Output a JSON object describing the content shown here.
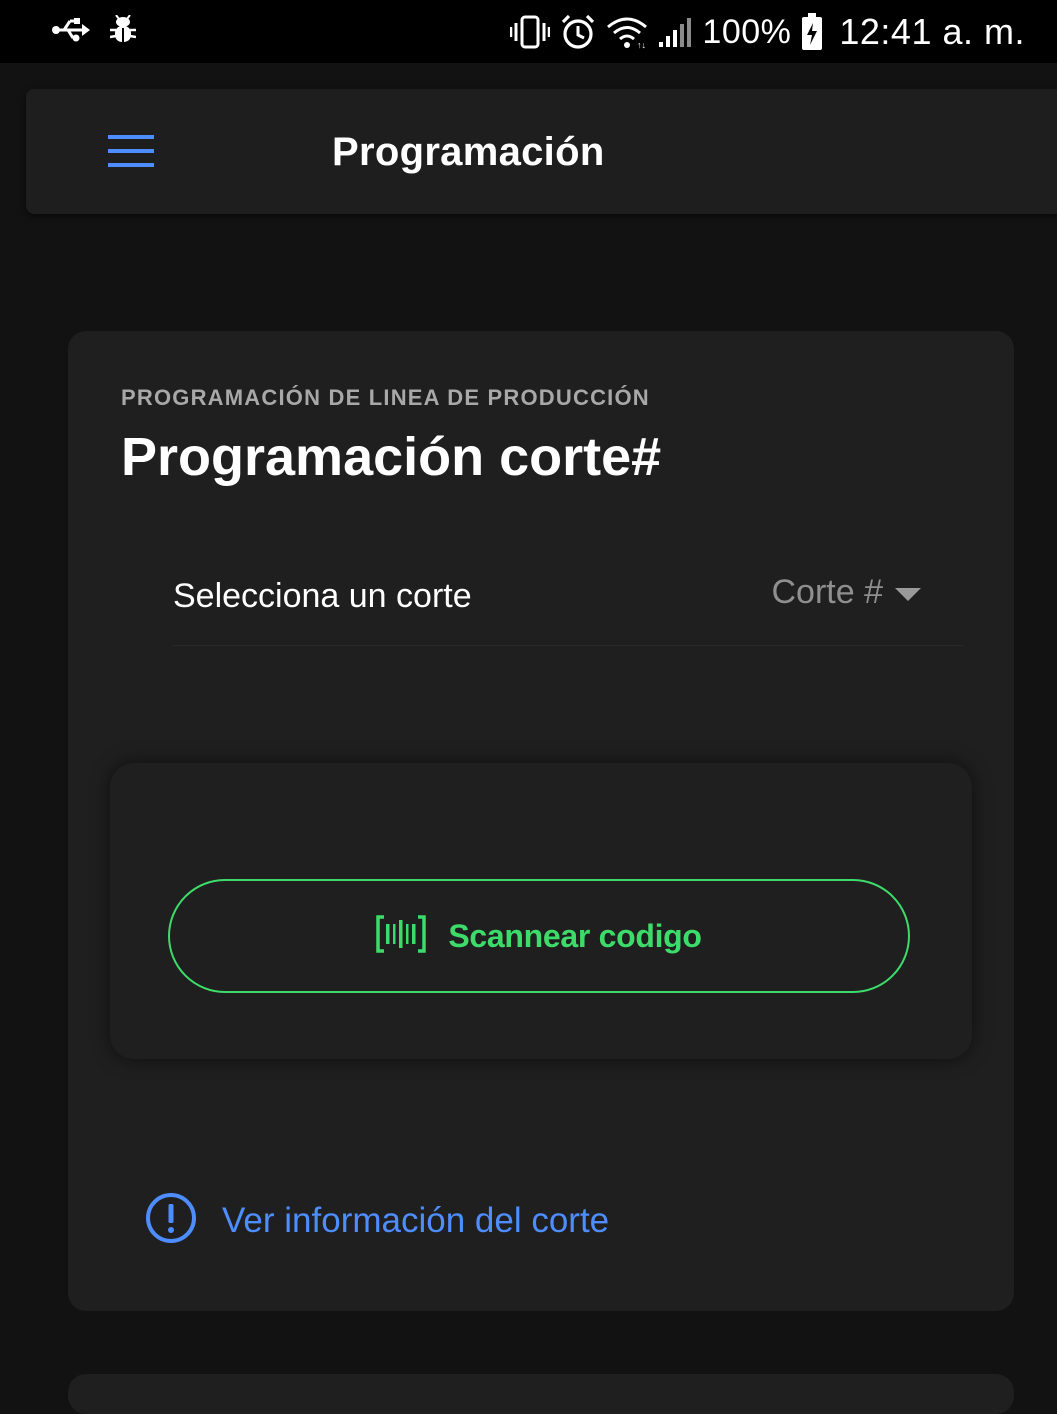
{
  "status_bar": {
    "battery_percent": "100%",
    "time": "12:41 a. m.",
    "icons": [
      "usb-icon",
      "bug-icon",
      "vibrate-icon",
      "alarm-icon",
      "wifi-icon",
      "signal-icon",
      "battery-charging-icon"
    ]
  },
  "app_bar": {
    "title": "Programación",
    "menu_icon": "hamburger-menu-icon",
    "accent_color": "#4d8dff"
  },
  "card": {
    "overline": "PROGRAMACIÓN DE LINEA DE PRODUCCIÓN",
    "title": "Programación corte#",
    "select": {
      "label": "Selecciona un corte",
      "value": "Corte #"
    },
    "scan_button": {
      "label": "Scannear codigo",
      "icon": "barcode-scan-icon",
      "color": "#3ddc6a"
    },
    "info_link": {
      "label": "Ver información del corte",
      "icon": "info-circle-icon",
      "color": "#4d8dff"
    }
  }
}
